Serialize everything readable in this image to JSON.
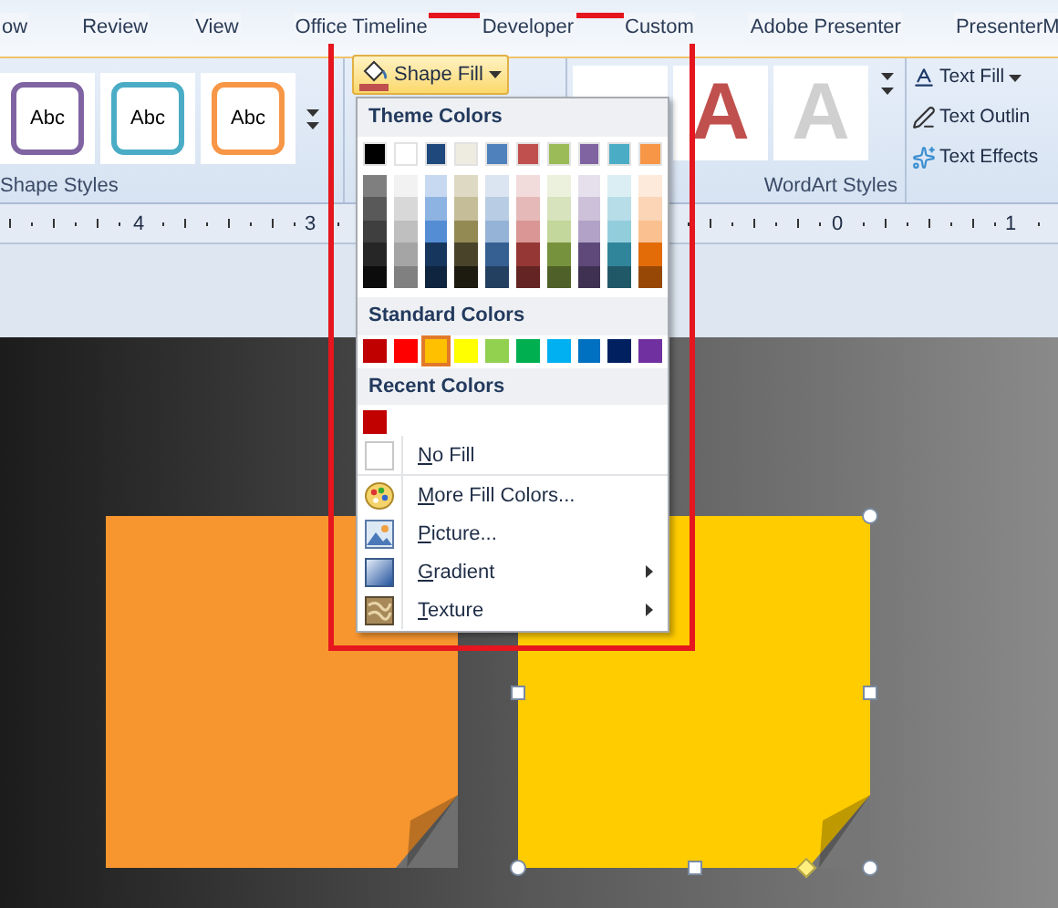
{
  "tabs": [
    {
      "label": "ow"
    },
    {
      "label": "Review"
    },
    {
      "label": "View"
    },
    {
      "label": "Office Timeline"
    },
    {
      "label": "Developer"
    },
    {
      "label": "Custom"
    },
    {
      "label": "Adobe Presenter"
    },
    {
      "label": "PresenterM"
    }
  ],
  "shape_styles": {
    "thumbnails": [
      {
        "text": "Abc",
        "color": "#8064a2"
      },
      {
        "text": "Abc",
        "color": "#4bacc6"
      },
      {
        "text": "Abc",
        "color": "#f79646"
      }
    ],
    "label": "Shape Styles"
  },
  "shape_fill_button": {
    "label": "Shape Fill"
  },
  "wordart_styles": {
    "thumbnails": [
      {
        "text": "A",
        "color": "#c0504d"
      },
      {
        "text": "A",
        "color": "#d0d0d0"
      }
    ],
    "label": "WordArt Styles"
  },
  "text_commands": [
    {
      "label": "Text Fill",
      "kind": "fill"
    },
    {
      "label": "Text Outlin",
      "kind": "outline"
    },
    {
      "label": "Text Effects",
      "kind": "effects"
    }
  ],
  "ruler": {
    "numbers": [
      "4",
      "3",
      "0",
      "1"
    ]
  },
  "menu": {
    "theme_header": "Theme Colors",
    "theme_colors": [
      {
        "color": "#000000",
        "shades": [
          {
            "color": "#7f7f7f"
          },
          {
            "color": "#595959"
          },
          {
            "color": "#3f3f3f"
          },
          {
            "color": "#262626"
          },
          {
            "color": "#0c0c0c"
          }
        ]
      },
      {
        "color": "#ffffff",
        "shades": [
          {
            "color": "#f2f2f2"
          },
          {
            "color": "#d8d8d8"
          },
          {
            "color": "#bfbfbf"
          },
          {
            "color": "#a5a5a5"
          },
          {
            "color": "#808080"
          }
        ]
      },
      {
        "color": "#1f497d",
        "shades": [
          {
            "color": "#c6d9f0"
          },
          {
            "color": "#8db3e2"
          },
          {
            "color": "#548dd4"
          },
          {
            "color": "#17365d"
          },
          {
            "color": "#0f243e"
          }
        ]
      },
      {
        "color": "#eeece1",
        "shades": [
          {
            "color": "#ddd9c3"
          },
          {
            "color": "#c4bd97"
          },
          {
            "color": "#938953"
          },
          {
            "color": "#494429"
          },
          {
            "color": "#1d1b10"
          }
        ]
      },
      {
        "color": "#4f81bd",
        "shades": [
          {
            "color": "#dbe5f1"
          },
          {
            "color": "#b8cce4"
          },
          {
            "color": "#95b3d7"
          },
          {
            "color": "#366092"
          },
          {
            "color": "#244061"
          }
        ]
      },
      {
        "color": "#c0504d",
        "shades": [
          {
            "color": "#f2dcdb"
          },
          {
            "color": "#e5b9b7"
          },
          {
            "color": "#d99694"
          },
          {
            "color": "#953734"
          },
          {
            "color": "#632423"
          }
        ]
      },
      {
        "color": "#9bbb59",
        "shades": [
          {
            "color": "#ebf1dd"
          },
          {
            "color": "#d7e3bc"
          },
          {
            "color": "#c3d69b"
          },
          {
            "color": "#76923c"
          },
          {
            "color": "#4f6128"
          }
        ]
      },
      {
        "color": "#8064a2",
        "shades": [
          {
            "color": "#e5e0ec"
          },
          {
            "color": "#ccc1d9"
          },
          {
            "color": "#b2a2c7"
          },
          {
            "color": "#5f497a"
          },
          {
            "color": "#3f3151"
          }
        ]
      },
      {
        "color": "#4bacc6",
        "shades": [
          {
            "color": "#dbeef3"
          },
          {
            "color": "#b7dde8"
          },
          {
            "color": "#92cddc"
          },
          {
            "color": "#31859b"
          },
          {
            "color": "#205867"
          }
        ]
      },
      {
        "color": "#f79646",
        "shades": [
          {
            "color": "#fdeada"
          },
          {
            "color": "#fbd5b5"
          },
          {
            "color": "#fac08f"
          },
          {
            "color": "#e36c09"
          },
          {
            "color": "#974806"
          }
        ]
      }
    ],
    "standard_header": "Standard Colors",
    "standard_colors": [
      {
        "color": "#c00000",
        "selected": false
      },
      {
        "color": "#ff0000",
        "selected": false
      },
      {
        "color": "#ffc000",
        "selected": true
      },
      {
        "color": "#ffff00",
        "selected": false
      },
      {
        "color": "#92d050",
        "selected": false
      },
      {
        "color": "#00b050",
        "selected": false
      },
      {
        "color": "#00b0f0",
        "selected": false
      },
      {
        "color": "#0070c0",
        "selected": false
      },
      {
        "color": "#002060",
        "selected": false
      },
      {
        "color": "#7030a0",
        "selected": false
      }
    ],
    "recent_header": "Recent Colors",
    "recent_colors": [
      {
        "color": "#c10000"
      }
    ],
    "items": [
      {
        "label": "No Fill",
        "kind": "nofill",
        "underline_first": true,
        "submenu": false
      },
      {
        "label": "More Fill Colors...",
        "kind": "palette",
        "underline_first": true,
        "submenu": false
      },
      {
        "label": "Picture...",
        "kind": "picture",
        "underline_first": true,
        "submenu": false
      },
      {
        "label": "Gradient",
        "kind": "gradient",
        "underline_first": true,
        "submenu": true
      },
      {
        "label": "Texture",
        "kind": "texture",
        "underline_first": true,
        "submenu": true
      }
    ]
  },
  "slide": {
    "notes": [
      {
        "color": "#f7962f",
        "selected": false
      },
      {
        "color": "#ffcc00",
        "selected": true
      }
    ]
  }
}
